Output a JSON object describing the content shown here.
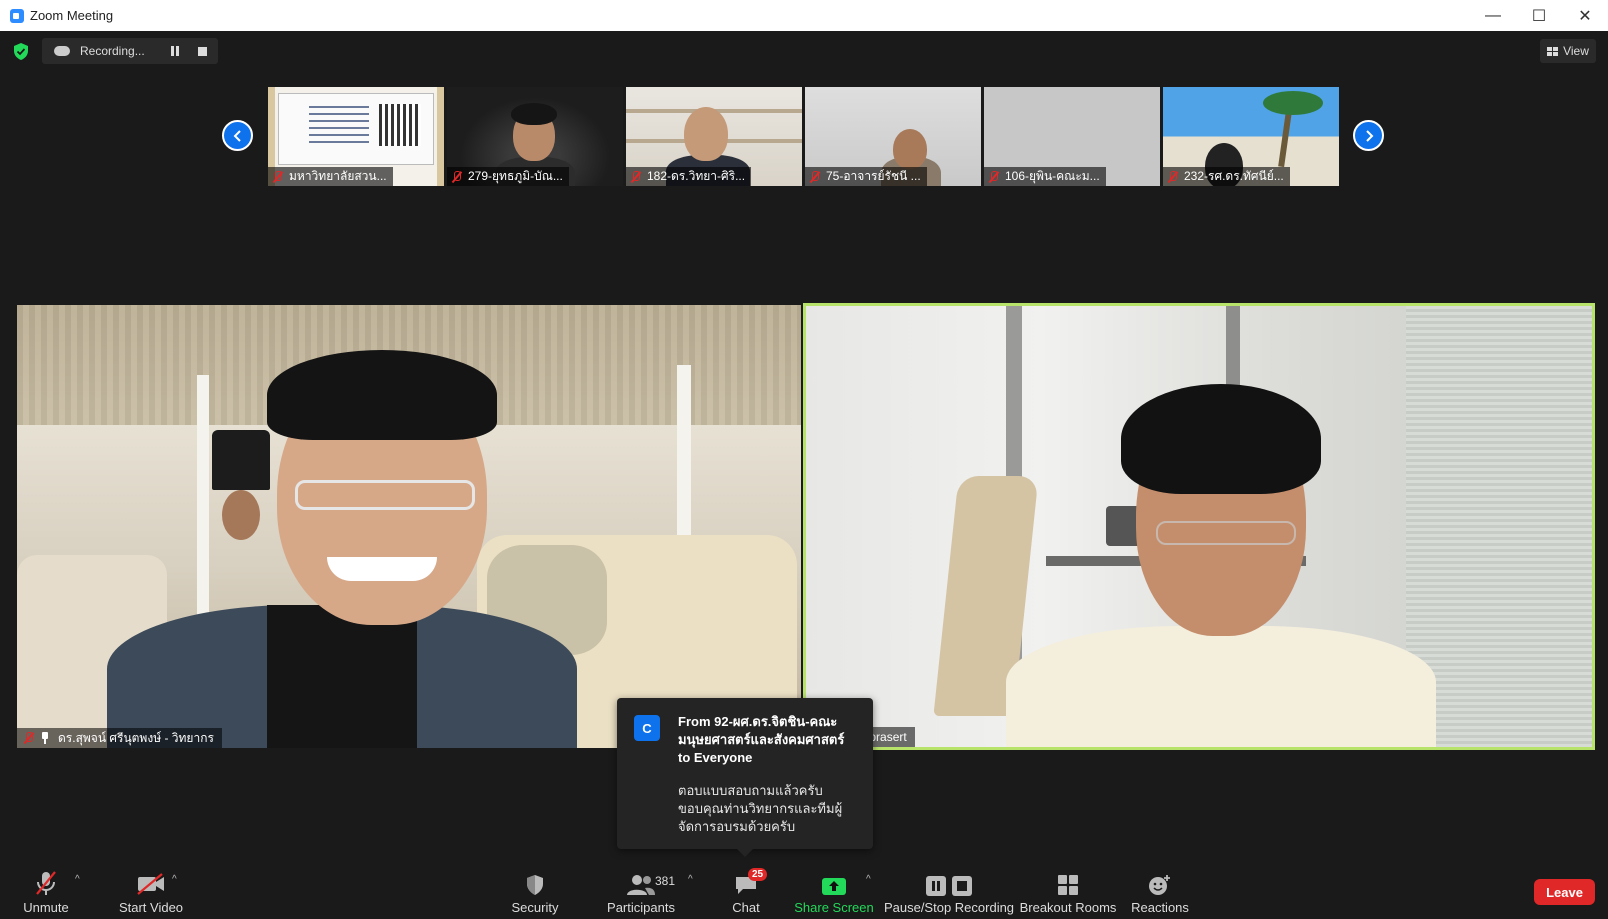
{
  "window": {
    "title": "Zoom Meeting"
  },
  "status": {
    "recording_text": "Recording...",
    "view_label": "View"
  },
  "thumbnails": [
    {
      "label": "มหาวิทยาลัยสวน..."
    },
    {
      "label": "279-ยุทธภูมิ-บัณ..."
    },
    {
      "label": "182-ดร.วิทยา-ศิริ..."
    },
    {
      "label": "75-อาจารย์รัชนี ..."
    },
    {
      "label": "106-ยุพิน-คณะม..."
    },
    {
      "label": "232-รศ.ดร.ทัศนีย์..."
    }
  ],
  "videos": {
    "left_name": "ดร.สุพจน์ ศรีนุตพงษ์ - วิทยากร",
    "right_name": "arn moungprasert"
  },
  "chat_popup": {
    "avatar_letter": "C",
    "from": "From 92-ผศ.ดร.จิตชิน-คณะมนุษยศาสตร์และสังคมศาสตร์ to Everyone",
    "message": "ตอบแบบสอบถามแล้วครับ ขอบคุณท่านวิทยากรและทีมผู้จัดการอบรมด้วยครับ"
  },
  "toolbar": {
    "unmute": "Unmute",
    "start_video": "Start Video",
    "security": "Security",
    "participants": "Participants",
    "participants_count": "381",
    "chat": "Chat",
    "chat_badge": "25",
    "share_screen": "Share Screen",
    "pause_stop_recording": "Pause/Stop Recording",
    "breakout_rooms": "Breakout Rooms",
    "reactions": "Reactions",
    "leave": "Leave"
  },
  "colors": {
    "accent_blue": "#0e72ed",
    "active_speaker_border": "#b7e36b",
    "leave_red": "#e02828",
    "share_green": "#23d959"
  }
}
